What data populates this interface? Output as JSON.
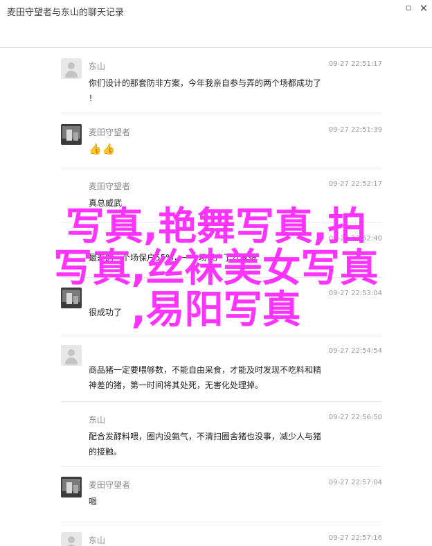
{
  "window": {
    "title": "麦田守望者与东山的聊天记录",
    "min_icon": "minimize-icon",
    "close_icon": "close-icon"
  },
  "messages": [
    {
      "sender": "东山",
      "time": "09-27 22:51:17",
      "avatar": "default",
      "lines": [
        "你们设计的那套防非方案，今年我亲自参与弄的两个场都成功了",
        "！"
      ]
    },
    {
      "sender": "麦田守望者",
      "time": "09-27 22:51:39",
      "avatar": "photo",
      "lines": [
        "👍👍"
      ]
    },
    {
      "sender": "麦田守望者",
      "time": "09-27 22:52:17",
      "avatar": "none",
      "lines": [
        "真总威武"
      ]
    },
    {
      "sender": "",
      "time": "09-27 22:52:40",
      "avatar": "none",
      "lines": [
        "最差的一个场保户55%，一个场保户了八成多"
      ]
    },
    {
      "sender": "",
      "time": "09-27 22:53:04",
      "avatar": "photo",
      "lines": [
        "很成功了"
      ]
    },
    {
      "sender": "",
      "time": "09-27 22:54:54",
      "avatar": "default",
      "lines": [
        "商品猪一定要喂够数，不能自由采食，才能及时发现不吃料和精",
        "神差的猪，第一时间将其处死，无害化处理掉。"
      ]
    },
    {
      "sender": "东山",
      "time": "09-27 22:56:50",
      "avatar": "none",
      "lines": [
        "配合发酵料喂，圈内没氨气，不清扫圈舍猪也没事，减少人与猪",
        "的接触。"
      ]
    },
    {
      "sender": "麦田守望者",
      "time": "09-27 22:57:04",
      "avatar": "photo",
      "lines": [
        "嗯"
      ]
    },
    {
      "sender": "东山",
      "time": "09-27 22:57:16",
      "avatar": "default",
      "lines": [
        ""
      ]
    }
  ],
  "overlay": {
    "lines": [
      "写真,艳舞写真,拍",
      "写真,丝袜美女写真",
      ",易阳写真"
    ],
    "color": "#ff33ff"
  }
}
